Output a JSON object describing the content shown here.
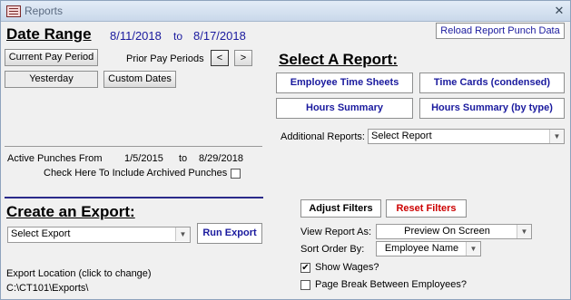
{
  "window": {
    "title": "Reports",
    "close_glyph": "✕"
  },
  "date_range": {
    "heading": "Date Range",
    "start_date": "8/11/2018",
    "to_label": "to",
    "end_date": "8/17/2018",
    "current_pay_period_label": "Current Pay Period",
    "prior_pay_periods_label": "Prior Pay Periods",
    "prev_label": "<",
    "next_label": ">",
    "yesterday_label": "Yesterday",
    "custom_dates_label": "Custom Dates"
  },
  "reload_button_label": "Reload Report Punch Data",
  "select_report": {
    "heading": "Select A Report:",
    "employee_time_sheets_label": "Employee Time Sheets",
    "time_cards_condensed_label": "Time Cards (condensed)",
    "hours_summary_label": "Hours Summary",
    "hours_summary_by_type_label": "Hours Summary (by type)",
    "additional_reports_label": "Additional Reports:",
    "additional_reports_value": "Select Report"
  },
  "active_punches": {
    "label": "Active Punches  From",
    "from_date": "1/5/2015",
    "to_label": "to",
    "to_date": "8/29/2018",
    "archived_label": "Check Here To Include Archived Punches",
    "archived_checked": false
  },
  "export": {
    "heading": "Create an Export:",
    "select_value": "Select Export",
    "run_label": "Run Export",
    "location_label": "Export Location (click to change)",
    "location_path": "C:\\CT101\\Exports\\"
  },
  "filters": {
    "adjust_label": "Adjust Filters",
    "reset_label": "Reset Filters",
    "view_as_label": "View Report As:",
    "view_as_value": "Preview On Screen",
    "sort_by_label": "Sort Order By:",
    "sort_by_value": "Employee Name",
    "show_wages_label": "Show Wages?",
    "show_wages_checked": true,
    "page_break_label": "Page Break Between Employees?",
    "page_break_checked": false,
    "check_glyph": "✔"
  },
  "colors": {
    "accent_blue": "#1a1a9e",
    "reset_red": "#cc0000",
    "divider": "#2a2a8a"
  }
}
